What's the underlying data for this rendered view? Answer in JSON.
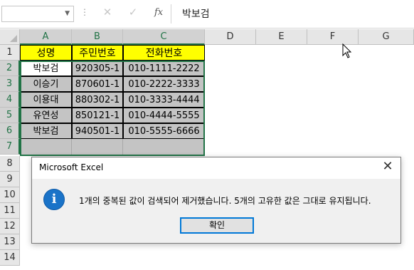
{
  "formula_bar": {
    "name_box": "",
    "cancel_icon": "✕",
    "enter_icon": "✓",
    "fx_label": "fx",
    "formula_value": "박보검"
  },
  "columns": [
    "A",
    "B",
    "C",
    "D",
    "E",
    "F",
    "G"
  ],
  "rows": [
    "1",
    "2",
    "3",
    "4",
    "5",
    "6",
    "7",
    "8",
    "9",
    "10",
    "11",
    "12",
    "13",
    "14"
  ],
  "table": {
    "headers": [
      "성명",
      "주민번호",
      "전화번호"
    ],
    "rows": [
      [
        "박보검",
        "920305-1",
        "010-1111-2222"
      ],
      [
        "이승기",
        "870601-1",
        "010-2222-3333"
      ],
      [
        "이용대",
        "880302-1",
        "010-3333-4444"
      ],
      [
        "유연성",
        "850121-1",
        "010-4444-5555"
      ],
      [
        "박보검",
        "940501-1",
        "010-5555-6666"
      ]
    ]
  },
  "colors": {
    "header_fill": "#ffff00",
    "selection_fill": "#c4c4c4",
    "excel_green": "#217346",
    "info_blue": "#1a73c8"
  },
  "dialog": {
    "title": "Microsoft Excel",
    "close_icon": "✕",
    "info_icon_glyph": "i",
    "message": "1개의 중복된 값이 검색되어 제거했습니다. 5개의 고유한 값은 그대로 유지됩니다.",
    "ok_label": "확인"
  }
}
